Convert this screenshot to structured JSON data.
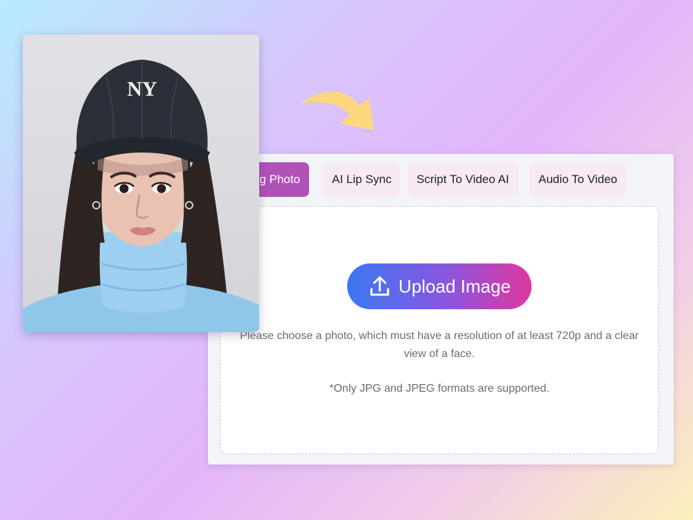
{
  "tabs": [
    {
      "label": "Talking Photo",
      "active": true
    },
    {
      "label": "AI Lip Sync",
      "active": false
    },
    {
      "label": "Script To Video AI",
      "active": false
    },
    {
      "label": "Audio To Video",
      "active": false
    }
  ],
  "upload": {
    "button_label": "Upload Image",
    "icon": "upload-icon",
    "hint_line1": "Please choose a photo, which must have a resolution of at least 720p and a clear",
    "hint_line2": "view of a face.",
    "formats_note": "*Only JPG and JPEG formats are supported."
  },
  "photo": {
    "cap_logo": "NY"
  },
  "colors": {
    "active_tab": "#b052b8",
    "tab_bg": "#f7eaf4",
    "button_gradient_start": "#3a78f2",
    "button_gradient_end": "#e0379e",
    "arrow": "#fdd77c"
  }
}
